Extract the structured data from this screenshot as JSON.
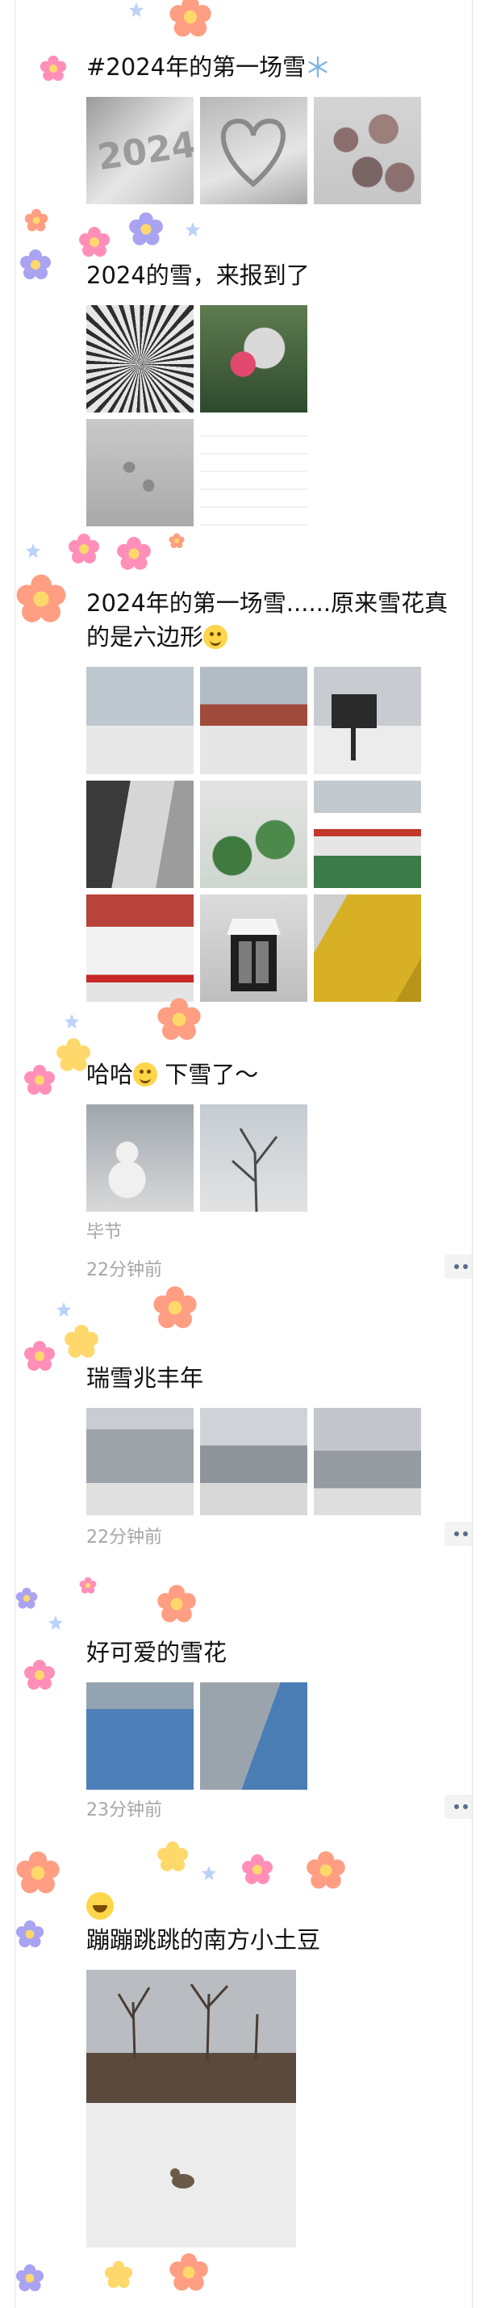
{
  "posts": [
    {
      "text": "#2024年的第一场雪",
      "emoji": "snowflake-icon",
      "photo_count": 3
    },
    {
      "text": "2024的雪，来报到了",
      "photo_count": 4
    },
    {
      "text_line1": "2024年的第一场雪......原来雪花真",
      "text_line2": "的是六边形",
      "emoji": "smile-icon",
      "photo_count": 9
    },
    {
      "text": "哈哈",
      "emoji": "laughing-icon",
      "text_after": " 下雪了～",
      "photo_count": 2,
      "location": "毕节",
      "time": "22分钟前"
    },
    {
      "text": "瑞雪兆丰年",
      "photo_count": 3,
      "time": "22分钟前"
    },
    {
      "text": "好可爱的雪花",
      "photo_count": 2,
      "time": "23分钟前"
    },
    {
      "emoji": "joy-icon",
      "text": "蹦蹦跳跳的南方小土豆",
      "photo_count": 1
    }
  ],
  "colors": {
    "flower_pink": "#ff8fb8",
    "flower_orange": "#ff9e82",
    "flower_purple": "#a9a3f2",
    "flower_yellow": "#ffd86b",
    "meta_gray": "#a6a6a6",
    "more_dots": "#5a6a8a"
  }
}
